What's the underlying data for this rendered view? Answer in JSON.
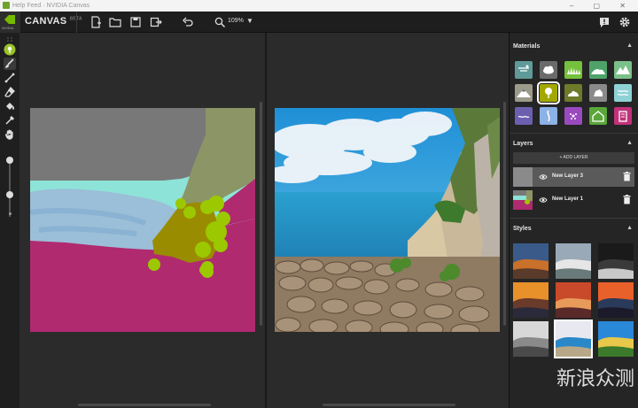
{
  "window": {
    "title": "Help  Feed  ·  NVIDIA Canvas",
    "controls": "–  ▢  ✕"
  },
  "app": {
    "brand_sub": "NVIDIA",
    "name": "CANVAS",
    "badge": "BETA",
    "zoom": "109%"
  },
  "toolbar": {
    "icons": [
      "new-file-icon",
      "open-folder-icon",
      "save-icon",
      "export-icon",
      "undo-icon",
      "zoom-icon",
      "help-icon",
      "settings-icon"
    ]
  },
  "tools": [
    "material-brush",
    "paintbrush",
    "line",
    "eraser",
    "fill",
    "eyedropper",
    "hand"
  ],
  "materials": {
    "title": "Materials",
    "items": [
      {
        "name": "sky",
        "color": "#5f9a9a"
      },
      {
        "name": "cloud",
        "color": "#6b6b6b"
      },
      {
        "name": "grass",
        "color": "#76c13c"
      },
      {
        "name": "hill",
        "color": "#4fa36a"
      },
      {
        "name": "mountain",
        "color": "#7bc08a"
      },
      {
        "name": "snow-mountain",
        "color": "#9c9a8a"
      },
      {
        "name": "tree",
        "color": "#a3a800"
      },
      {
        "name": "bush",
        "color": "#6f7a2a"
      },
      {
        "name": "rock",
        "color": "#8a8a8a"
      },
      {
        "name": "water",
        "color": "#8ed2d6"
      },
      {
        "name": "sea",
        "color": "#6c5fb0"
      },
      {
        "name": "river",
        "color": "#8cb2e6"
      },
      {
        "name": "flower",
        "color": "#9a4abf"
      },
      {
        "name": "house",
        "color": "#5aa63a"
      },
      {
        "name": "building",
        "color": "#c2327a"
      }
    ],
    "selected_index": 6
  },
  "layers": {
    "title": "Layers",
    "add_label": "+ ADD LAYER",
    "items": [
      {
        "name": "New Layer 3",
        "active": true
      },
      {
        "name": "New Layer 1",
        "active": false
      }
    ]
  },
  "styles": {
    "title": "Styles",
    "count": 12,
    "selected_index": 7
  },
  "colors": {
    "accent": "#76b900",
    "panel": "#252525",
    "workspace": "#2b2b2b",
    "canvas_cloud": "#7a7a7a",
    "canvas_sky": "#8ee3d8",
    "canvas_rock": "#8b9466",
    "canvas_building": "#b02a70",
    "canvas_water": "#9bbfd8",
    "canvas_bush": "#a09000",
    "canvas_tree": "#a8c800"
  },
  "watermark": "新浪众测"
}
